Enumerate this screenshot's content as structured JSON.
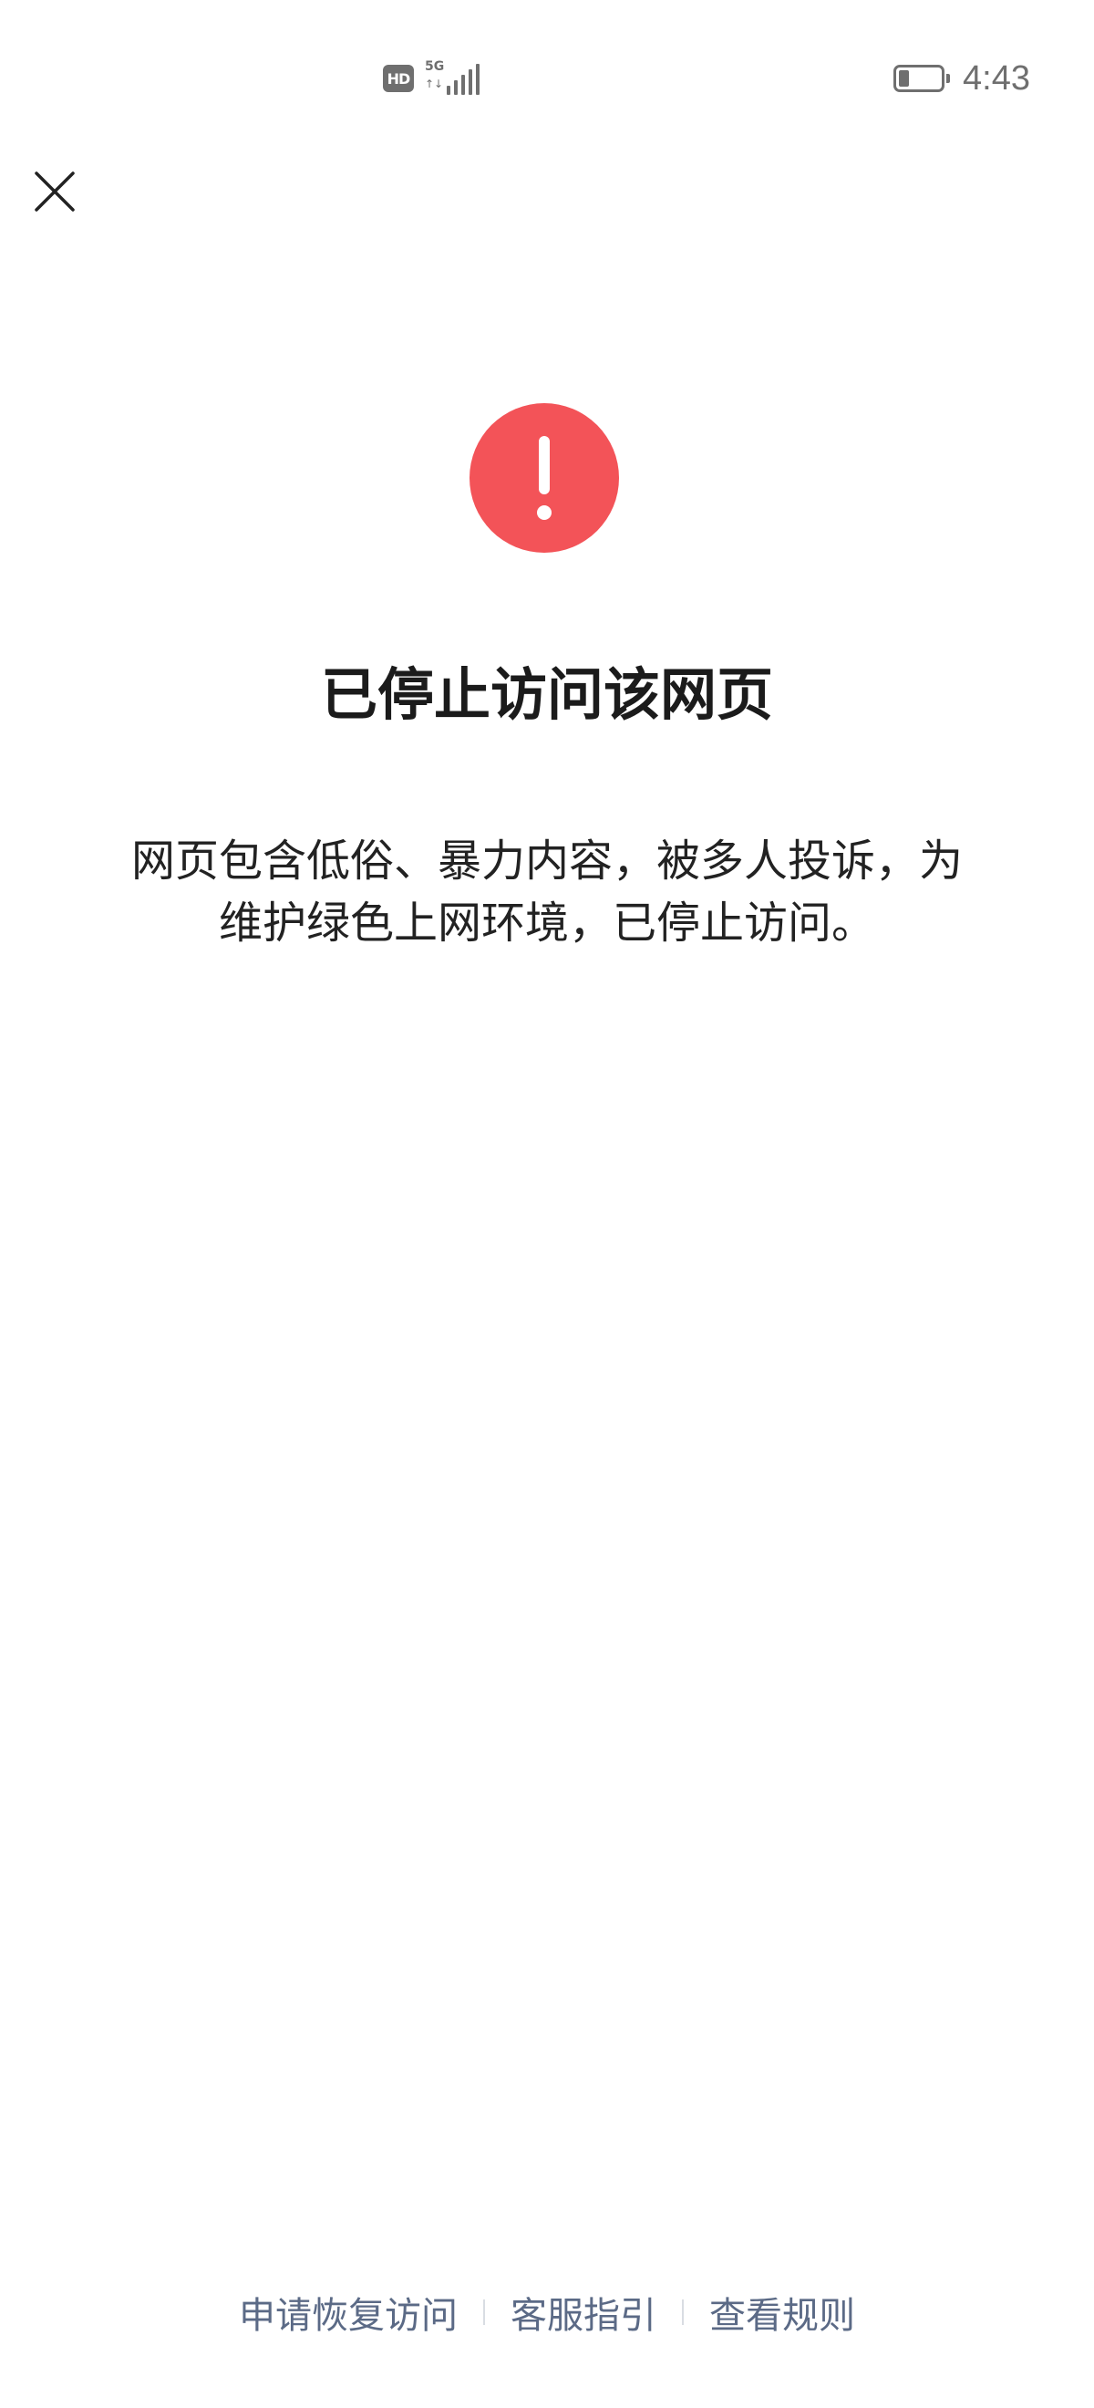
{
  "status_bar": {
    "hd_label": "HD",
    "network_label": "5G",
    "network_arrows": "↑↓",
    "time": "4:43",
    "battery_icon": "battery-low-icon",
    "signal_icon": "signal-bars-icon"
  },
  "close": {
    "icon": "close-icon"
  },
  "alert": {
    "icon": "exclamation-circle-icon",
    "color": "#f35358"
  },
  "content": {
    "title": "已停止访问该网页",
    "description_line1": "网页包含低俗、暴力内容，被多人投诉，为",
    "description_line2": "维护绿色上网环境，已停止访问。"
  },
  "footer": {
    "links": [
      {
        "label": "申请恢复访问"
      },
      {
        "label": "客服指引"
      },
      {
        "label": "查看规则"
      }
    ],
    "link_color": "#5b6a86"
  }
}
